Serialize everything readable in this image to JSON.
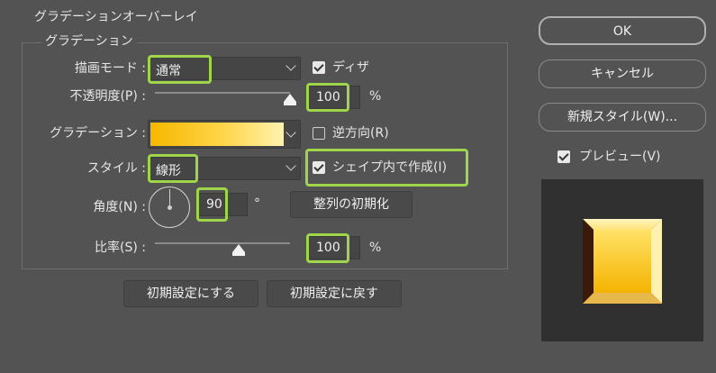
{
  "dialog": {
    "outer_group_title": "グラデーションオーバーレイ",
    "inner_group_title": "グラデーション"
  },
  "form": {
    "blend_mode_label": "描画モード :",
    "blend_mode_value": "通常",
    "dither_label": "ディザ",
    "dither_checked": true,
    "opacity_label": "不透明度(P) :",
    "opacity_value": "100",
    "opacity_unit": "%",
    "opacity_level": 1.0,
    "gradient_label": "グラデーション :",
    "gradient_colors": [
      "#f6b800",
      "#ffd54a",
      "#fff3b0"
    ],
    "reverse_label": "逆方向(R)",
    "reverse_checked": false,
    "style_label": "スタイル :",
    "style_value": "線形",
    "align_label": "シェイプ内で作成(I)",
    "align_checked": true,
    "angle_label": "角度(N) :",
    "angle_value": "90",
    "angle_unit": "°",
    "reset_align_button": "整列の初期化",
    "scale_label": "比率(S) :",
    "scale_value": "100",
    "scale_unit": "%",
    "scale_level": 0.6
  },
  "buttons": {
    "make_default": "初期設定にする",
    "reset_default": "初期設定に戻す",
    "ok": "OK",
    "cancel": "キャンセル",
    "new_style": "新規スタイル(W)..."
  },
  "preview": {
    "label": "プレビュー(V)",
    "checked": true
  },
  "colors": {
    "highlight": "#9fd54b",
    "background": "#535353"
  }
}
